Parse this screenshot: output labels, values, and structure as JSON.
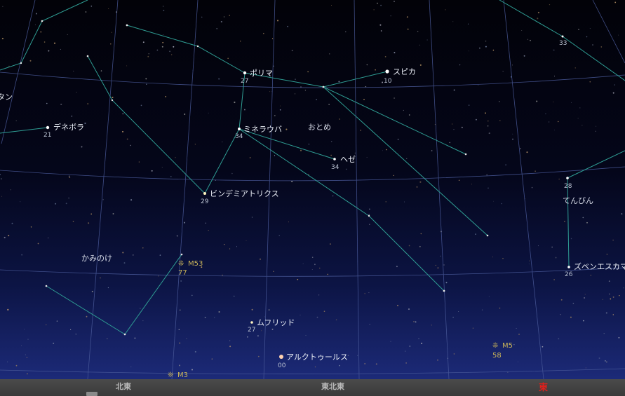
{
  "stars": [
    {
      "name": "ポリマ",
      "mag": "27"
    },
    {
      "name": "スピカ",
      "mag": "10"
    },
    {
      "name": "デネボラ",
      "mag": "21"
    },
    {
      "name": "ミネラウバ",
      "mag": "34"
    },
    {
      "name": "ヘゼ",
      "mag": "34"
    },
    {
      "name": "ビンデミアトリクス",
      "mag": "29"
    },
    {
      "name": "ムフリッド",
      "mag": "27"
    },
    {
      "name": "アルクトゥールス",
      "mag": "00"
    },
    {
      "name": "ズベンエスカマリ",
      "mag": "26"
    },
    {
      "name": "",
      "mag": "28"
    },
    {
      "name": "",
      "mag": "33"
    },
    {
      "name": "タン",
      "mag": ""
    }
  ],
  "constellations": [
    "おとめ",
    "かみのけ",
    "てんびん"
  ],
  "deep_sky": [
    {
      "name": "M53",
      "mag": "77"
    },
    {
      "name": "M5",
      "mag": "58"
    },
    {
      "name": "M3",
      "mag": ""
    }
  ],
  "directions": [
    "北東",
    "東北東",
    "東"
  ],
  "colors": {
    "constellation_line": "#2f9e94",
    "grid_line": "#4a5a9a",
    "dso": "#c9b45a",
    "east_marker": "#e0201c"
  }
}
